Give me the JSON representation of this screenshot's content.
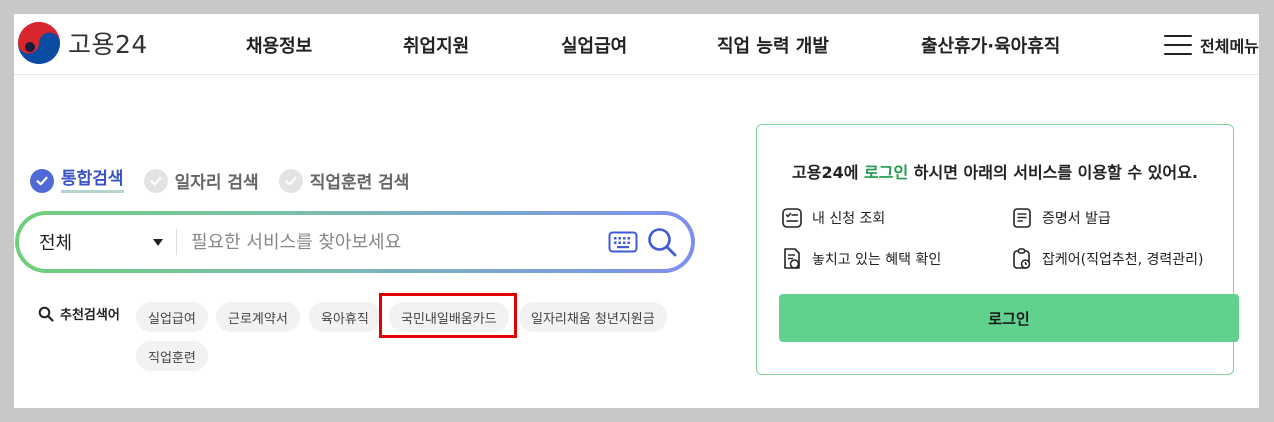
{
  "header": {
    "logo_text": "고용24",
    "nav": [
      "채용정보",
      "취업지원",
      "실업급여",
      "직업 능력 개발",
      "출산휴가·육아휴직"
    ],
    "menu_label": "전체메뉴"
  },
  "search": {
    "tabs": [
      {
        "label": "통합검색",
        "active": true
      },
      {
        "label": "일자리 검색",
        "active": false
      },
      {
        "label": "직업훈련 검색",
        "active": false
      }
    ],
    "category_selected": "전체",
    "placeholder": "필요한 서비스를 찾아보세요",
    "keyboard_icon": "keyboard-icon",
    "search_icon": "search-icon"
  },
  "recommended": {
    "label": "추천검색어",
    "keywords": [
      "실업급여",
      "근로계약서",
      "육아휴직",
      "국민내일배움카드",
      "일자리채움 청년지원금",
      "직업훈련"
    ],
    "highlighted": "국민내일배움카드"
  },
  "login_panel": {
    "title_prefix": "고용24에 ",
    "title_accent": "로그인",
    "title_suffix": " 하시면 아래의 서비스를 이용할 수 있어요.",
    "services": [
      {
        "label": "내 신청 조회",
        "icon": "checklist-icon"
      },
      {
        "label": "증명서 발급",
        "icon": "certificate-icon"
      },
      {
        "label": "놓치고 있는 혜택 확인",
        "icon": "benefit-doc-icon"
      },
      {
        "label": "잡케어(직업추천, 경력관리)",
        "icon": "jobcare-clipboard-icon"
      }
    ],
    "button_label": "로그인"
  },
  "colors": {
    "accent_green": "#1f9b4b",
    "button_green": "#61d18e",
    "tab_active": "#3954c6",
    "highlight_red": "#e30000"
  }
}
